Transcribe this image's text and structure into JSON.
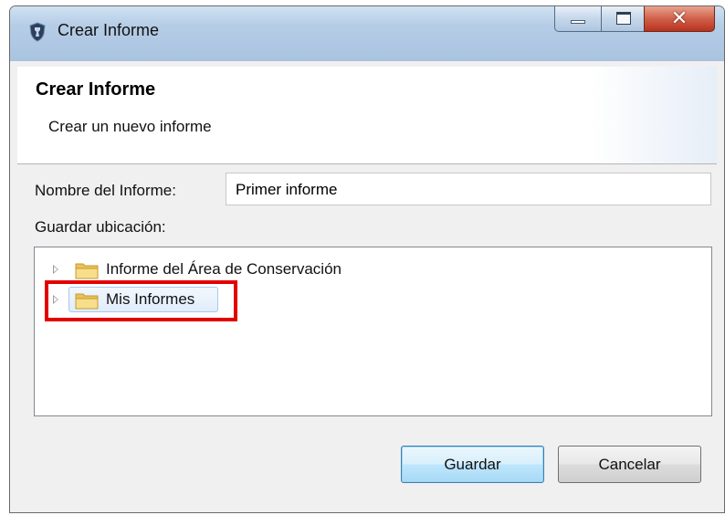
{
  "window": {
    "title": "Crear Informe"
  },
  "header": {
    "title": "Crear Informe",
    "subtitle": "Crear un nuevo informe"
  },
  "form": {
    "name_label": "Nombre del Informe:",
    "name_value": "Primer informe",
    "location_label": "Guardar ubicación:"
  },
  "tree": {
    "items": [
      {
        "label": "Informe del Área de Conservación",
        "icon": "folder-icon",
        "selected": false
      },
      {
        "label": "Mis Informes",
        "icon": "folder-icon",
        "selected": true
      }
    ]
  },
  "buttons": {
    "save_label": "Guardar",
    "cancel_label": "Cancelar"
  },
  "colors": {
    "highlight": "#e30000",
    "primary_button": "#bee6fd",
    "close_button": "#c84a34"
  }
}
